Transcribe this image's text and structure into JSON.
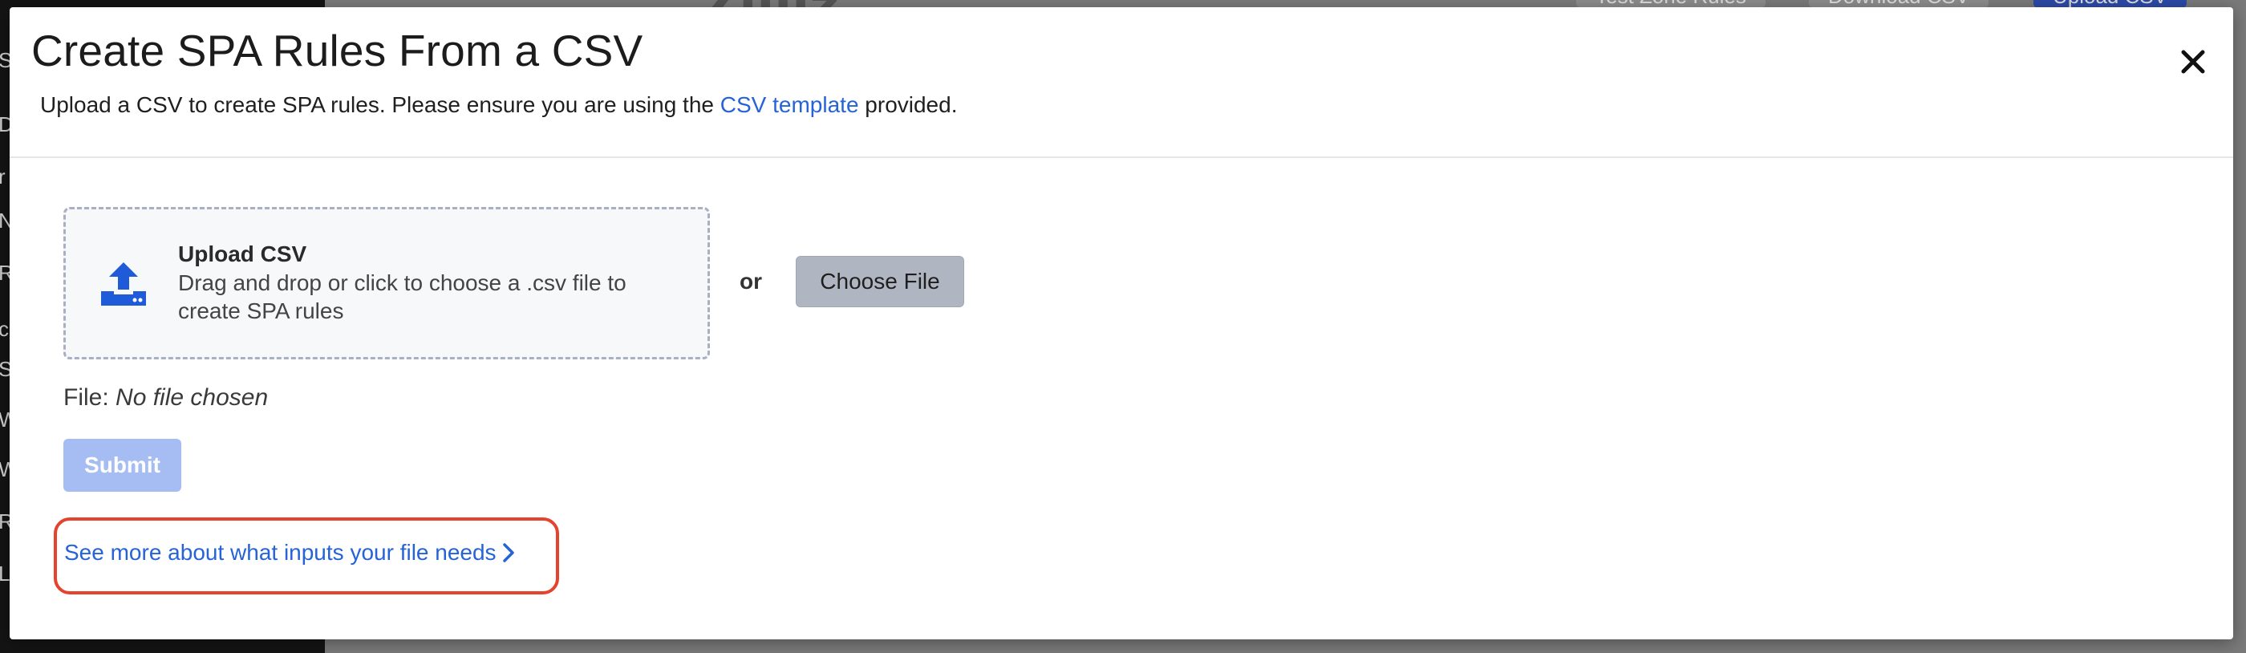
{
  "background": {
    "brand_text": "Zilliz",
    "side_letters": [
      "S",
      "D",
      "r",
      "N",
      "R",
      "c",
      "S",
      "W",
      "W",
      "R",
      "L"
    ],
    "buttons": {
      "test_zone": "Test Zone Rules",
      "download": "Download CSV",
      "upload": "Upload CSV"
    }
  },
  "modal": {
    "title": "Create SPA Rules From a CSV",
    "description_prefix": "Upload a CSV to create SPA rules. Please ensure you are using the",
    "template_link": "CSV template",
    "description_suffix": "provided.",
    "close_icon": "close-icon",
    "dropzone": {
      "icon": "upload-tray-icon",
      "title": "Upload CSV",
      "text": "Drag and drop or click to choose a .csv file to create SPA rules"
    },
    "or_label": "or",
    "choose_file_label": "Choose File",
    "file_label": "File:",
    "file_value": "No file chosen",
    "submit_label": "Submit",
    "more_link": "See more about what inputs your file needs",
    "more_link_icon": "chevron-right-icon"
  },
  "colors": {
    "accent": "#2563d6",
    "submit_disabled": "#a6bdf3",
    "highlight": "#e5432d"
  }
}
